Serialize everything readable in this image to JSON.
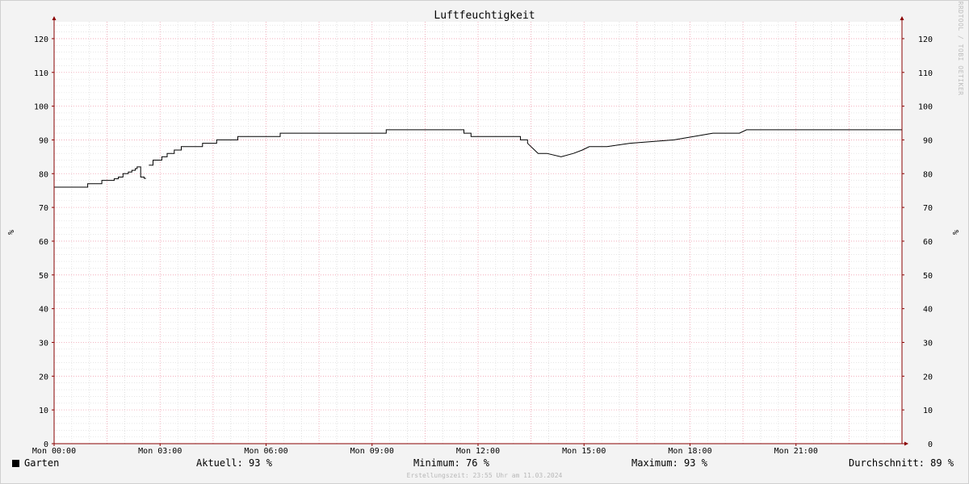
{
  "chart_data": {
    "type": "line",
    "title": "Luftfeuchtigkeit",
    "ylabel": "%",
    "ylabel_right": "%",
    "ylim": [
      0,
      125
    ],
    "yticks": [
      0,
      10,
      20,
      30,
      40,
      50,
      60,
      70,
      80,
      90,
      100,
      110,
      120
    ],
    "xlim_hours": [
      0,
      24
    ],
    "xtick_labels": [
      "Mon 00:00",
      "Mon 03:00",
      "Mon 06:00",
      "Mon 09:00",
      "Mon 12:00",
      "Mon 15:00",
      "Mon 18:00",
      "Mon 21:00"
    ],
    "xtick_hours": [
      0,
      3,
      6,
      9,
      12,
      15,
      18,
      21
    ],
    "grid": true,
    "series": [
      {
        "name": "Garten",
        "color": "#000000",
        "x_hours": [
          0,
          0.95,
          0.95,
          1.35,
          1.35,
          1.7,
          1.7,
          1.82,
          1.82,
          1.95,
          1.95,
          2.1,
          2.1,
          2.2,
          2.2,
          2.3,
          2.3,
          2.35,
          2.35,
          2.45,
          2.45,
          2.55,
          2.55,
          2.6,
          2.68,
          2.68,
          2.8,
          2.8,
          2.9,
          2.9,
          3.05,
          3.05,
          3.2,
          3.2,
          3.4,
          3.4,
          3.6,
          3.6,
          3.8,
          3.8,
          4.2,
          4.2,
          4.6,
          4.6,
          5.2,
          5.2,
          6.4,
          6.4,
          9.4,
          9.4,
          11.6,
          11.6,
          11.8,
          11.8,
          13.2,
          13.2,
          13.4,
          13.4,
          13.45,
          13.5,
          13.55,
          13.6,
          13.65,
          13.7,
          13.75,
          13.8,
          13.85,
          13.9,
          13.95,
          14.35,
          14.35,
          14.7,
          14.7,
          14.95,
          14.95,
          15.15,
          15.15,
          15.65,
          15.65,
          16.3,
          16.3,
          17.55,
          17.55,
          18.1,
          18.1,
          18.65,
          18.65,
          19.4,
          19.4,
          19.6,
          19.6,
          24
        ],
        "values": [
          76,
          76,
          77,
          77,
          78,
          78,
          78.5,
          78.5,
          79,
          79,
          80,
          80,
          80.5,
          80.5,
          81,
          81,
          81.5,
          81.5,
          82,
          82,
          79,
          79,
          78.6,
          78.6,
          null,
          82.5,
          82.5,
          84,
          84,
          84,
          84,
          85,
          85,
          86,
          86,
          87,
          87,
          88,
          88,
          88,
          88,
          89,
          89,
          90,
          90,
          91,
          91,
          92,
          92,
          93,
          93,
          92,
          92,
          91,
          91,
          90,
          90,
          89,
          88.5,
          88,
          87.5,
          87,
          86.5,
          86,
          86,
          86,
          86,
          86,
          86,
          85,
          85,
          86,
          86,
          87,
          87,
          88,
          88,
          88,
          88,
          89,
          89,
          90,
          90,
          91,
          91,
          92,
          92,
          92,
          92,
          93,
          93,
          93
        ]
      }
    ]
  },
  "legend": {
    "series_label": "Garten",
    "aktuell_label": "Aktuell:",
    "aktuell_value": "93 %",
    "minimum_label": "Minimum:",
    "minimum_value": "76 %",
    "maximum_label": "Maximum:",
    "maximum_value": "93 %",
    "durchschnitt_label": "Durchschnitt:",
    "durchschnitt_value": "89 %"
  },
  "footer": "Erstellungszeit: 23:55 Uhr am 11.03.2024",
  "watermark": "RRDTOOL / TOBI OETIKER",
  "colors": {
    "background": "#f3f3f3",
    "plot_background": "#ffffff",
    "major_grid": "#f0a0b0",
    "minor_grid": "#d8d8d8",
    "axis": "#8a0000",
    "line": "#000000"
  }
}
